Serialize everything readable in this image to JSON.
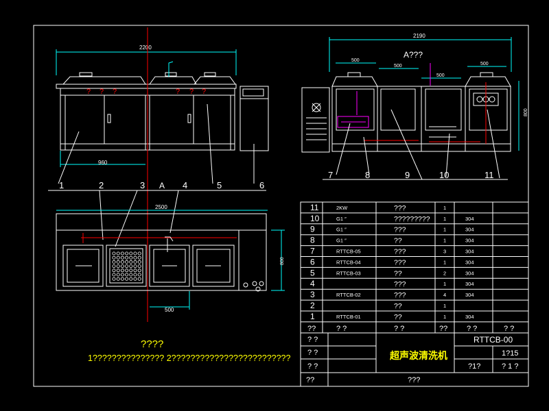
{
  "front_view": {
    "dim_total": "2200",
    "dim_part": "960",
    "marks": [
      "?",
      "?",
      "?"
    ],
    "marks_right": [
      "?",
      "?",
      "?"
    ]
  },
  "side_view": {
    "title": "A???",
    "dim_total": "2190",
    "dim_a": "500",
    "dim_b": "500",
    "dim_c": "500",
    "dim_d": "500",
    "dim_height": "800"
  },
  "plan_view": {
    "dim_total": "2500",
    "dim_bottom": "500",
    "dim_height": "800",
    "section_label": "A"
  },
  "callouts": {
    "top": [
      "1",
      "2",
      "3",
      "4",
      "5",
      "6"
    ],
    "side": [
      "7",
      "8",
      "9",
      "10",
      "11"
    ]
  },
  "notes": {
    "title": "????",
    "line": "1???????????????  2?????????????????????????"
  },
  "parts_table": {
    "rows": [
      {
        "no": "11",
        "code": "2KW",
        "name": "???",
        "qty": "1",
        "mat": ""
      },
      {
        "no": "10",
        "code": "G1 ″",
        "name": "?????????",
        "qty": "1",
        "mat": "304"
      },
      {
        "no": "9",
        "code": "G1 ″",
        "name": "???",
        "qty": "1",
        "mat": "304"
      },
      {
        "no": "8",
        "code": "G1 ″",
        "name": "??",
        "qty": "1",
        "mat": "304"
      },
      {
        "no": "7",
        "code": "RTTCB-05",
        "name": "???",
        "qty": "3",
        "mat": "304"
      },
      {
        "no": "6",
        "code": "RTTCB-04",
        "name": "???",
        "qty": "1",
        "mat": "304"
      },
      {
        "no": "5",
        "code": "RTTCB-03",
        "name": "??",
        "qty": "2",
        "mat": "304"
      },
      {
        "no": "4",
        "code": "",
        "name": "???",
        "qty": "1",
        "mat": "304"
      },
      {
        "no": "3",
        "code": "RTTCB-02",
        "name": "???",
        "qty": "4",
        "mat": "304"
      },
      {
        "no": "2",
        "code": "",
        "name": "??",
        "qty": "1",
        "mat": ""
      },
      {
        "no": "1",
        "code": "RTTCB-01",
        "name": "??",
        "qty": "1",
        "mat": "304"
      }
    ],
    "header": {
      "no": "??",
      "code": "? ?",
      "name": "? ?",
      "qty": "??",
      "mat": "? ?",
      "note": "? ?"
    }
  },
  "title_block": {
    "drawing_no": "RTTCB-00",
    "name": "超声波清洗机",
    "scale": "1?15",
    "sheet": "?1?",
    "sheets": "? 1 ?",
    "l1": "? ?",
    "l2": "? ?",
    "l3": "? ?",
    "l4": "??",
    "bottom": "???"
  },
  "colors": {
    "background": "#000000",
    "line": "#ffffff",
    "cyan": "#00ffff",
    "red": "#ff0000",
    "magenta": "#ff00ff",
    "yellow": "#ffff00",
    "green": "#00ff00"
  }
}
